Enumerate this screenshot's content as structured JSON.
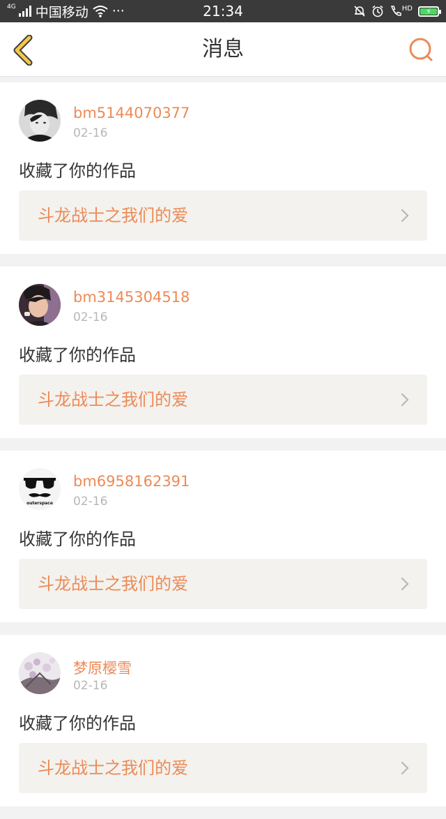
{
  "status_bar": {
    "network": "4G",
    "carrier": "中国移动",
    "more": "···",
    "time": "21:34",
    "hd": "HD"
  },
  "header": {
    "title": "消息",
    "back_icon": "chevron-left-icon",
    "search_icon": "search-icon"
  },
  "colors": {
    "accent": "#ec8a56",
    "back": "#f2c84b",
    "card_link_bg": "#f3f2ee",
    "status_bar": "#3a3a3a"
  },
  "notifications": [
    {
      "username": "bm5144070377",
      "date": "02-16",
      "action": "收藏了你的作品",
      "work": "斗龙战士之我们的爱"
    },
    {
      "username": "bm3145304518",
      "date": "02-16",
      "action": "收藏了你的作品",
      "work": "斗龙战士之我们的爱"
    },
    {
      "username": "bm6958162391",
      "date": "02-16",
      "action": "收藏了你的作品",
      "work": "斗龙战士之我们的爱"
    },
    {
      "username": "梦原樱雪",
      "date": "02-16",
      "action": "收藏了你的作品",
      "work": "斗龙战士之我们的爱"
    }
  ],
  "avatar3_caption": "outerspace"
}
